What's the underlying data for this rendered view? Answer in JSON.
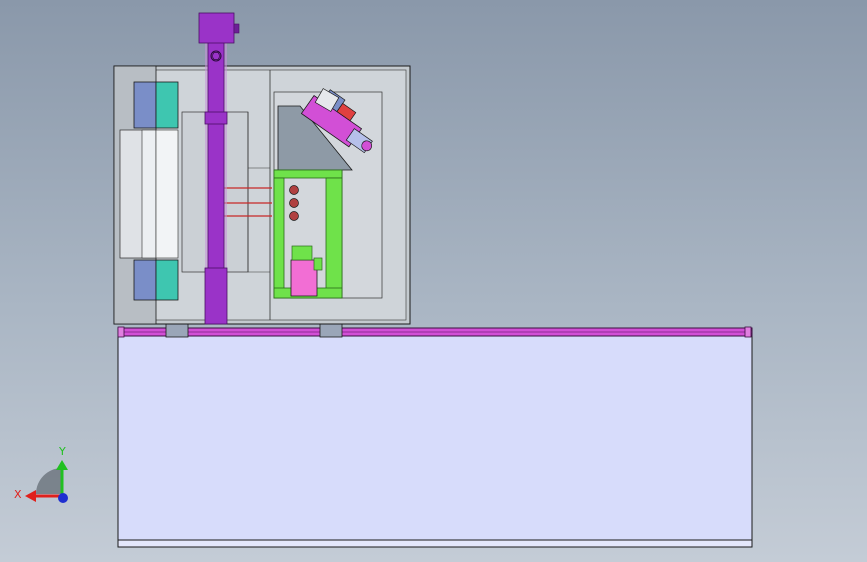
{
  "viewport": {
    "background_top": "#8a98aa",
    "background_bottom": "#c4ccd6"
  },
  "triad": {
    "x_label": "X",
    "y_label": "Y",
    "x_color": "#e0201c",
    "y_color": "#21c021",
    "z_color": "#1f2fd0"
  },
  "colors": {
    "purple": "#9a33c8",
    "purple_dark": "#6d1f96",
    "magenta": "#d24fd6",
    "base_fill": "#d7dcfb",
    "cabinet": "#c4cacf",
    "cabinet_panel": "#cfd4d9",
    "teal": "#3ec6b0",
    "blue_block": "#7a8ec8",
    "green_frame": "#6fe24a",
    "pink": "#f26ed4",
    "gray_plate": "#8e9aa6",
    "red_line": "#c82828"
  }
}
